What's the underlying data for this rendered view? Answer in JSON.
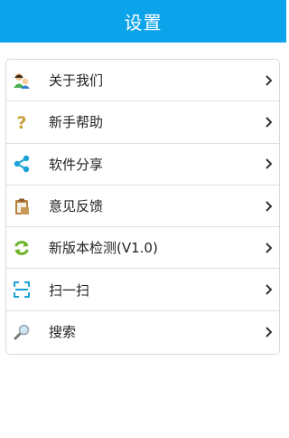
{
  "header": {
    "title": "设置"
  },
  "colors": {
    "header_bg": "#0ba3e9",
    "text": "#222222",
    "divider": "#dedede"
  },
  "menu": {
    "items": [
      {
        "label": "关于我们",
        "icon": "about-us-icon"
      },
      {
        "label": "新手帮助",
        "icon": "help-icon"
      },
      {
        "label": "软件分享",
        "icon": "share-icon"
      },
      {
        "label": "意见反馈",
        "icon": "feedback-icon"
      },
      {
        "label": "新版本检测(V1.0)",
        "icon": "update-icon"
      },
      {
        "label": "扫一扫",
        "icon": "scan-icon"
      },
      {
        "label": "搜索",
        "icon": "search-icon"
      }
    ]
  }
}
